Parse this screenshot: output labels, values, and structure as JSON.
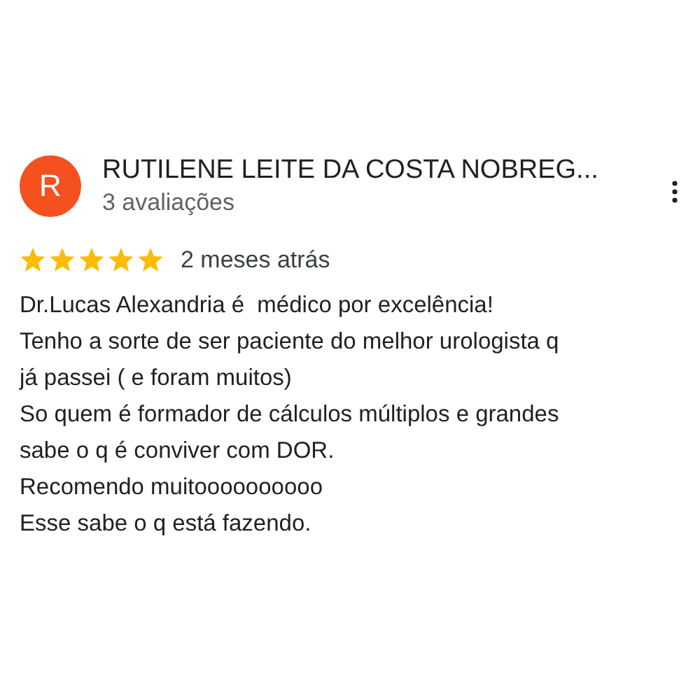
{
  "review": {
    "avatar_letter": "R",
    "author": "RUTILENE LEITE DA COSTA NOBREG...",
    "review_count": "3 avaliações",
    "stars": 5,
    "time": "2 meses atrás",
    "text": "Dr.Lucas Alexandria é  médico por excelência!\nTenho a sorte de ser paciente do melhor urologista q\njá passei ( e foram muitos)\nSo quem é formador de cálculos múltiplos e grandes\nsabe o q é conviver com DOR.\nRecomendo muitoooooooooo\nEsse sabe o q está fazendo."
  }
}
